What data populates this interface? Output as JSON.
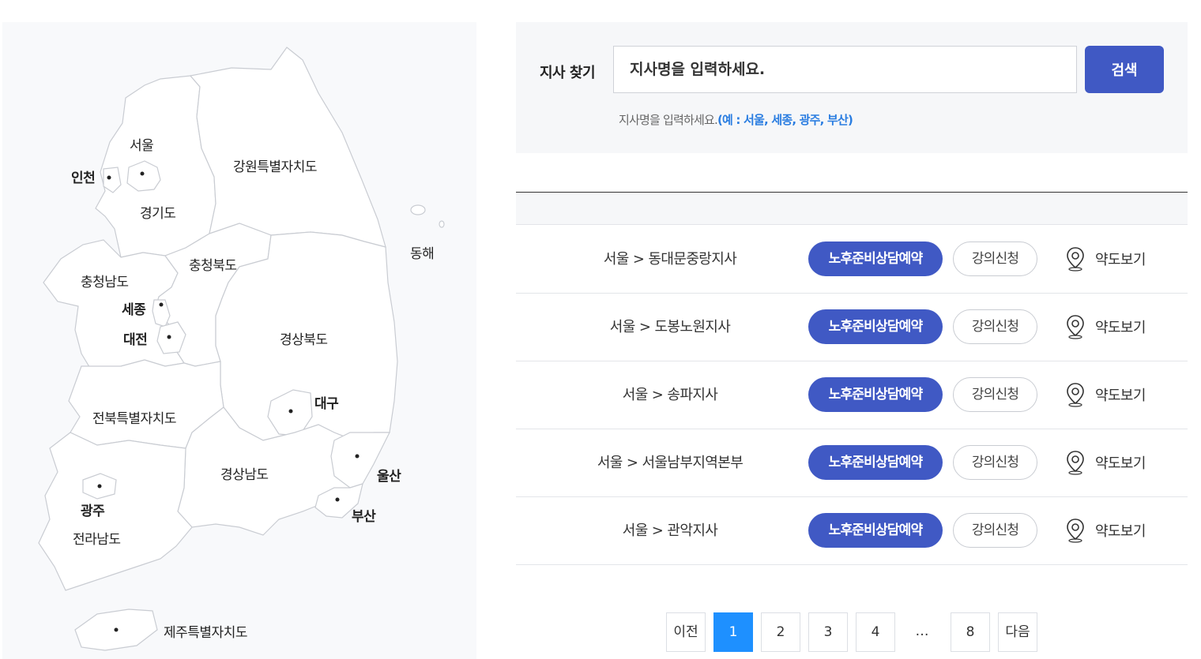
{
  "map": {
    "regions": {
      "gangwon": "강원특별자치도",
      "gyeonggi": "경기도",
      "chungbuk": "충청북도",
      "chungnam": "충청남도",
      "gyeongbuk": "경상북도",
      "jeonbuk": "전북특별자치도",
      "gyeongnam": "경상남도",
      "jeonnam": "전라남도",
      "jeju": "제주특별자치도",
      "east_sea": "동해"
    },
    "cities": {
      "seoul": "서울",
      "incheon": "인천",
      "sejong": "세종",
      "daejeon": "대전",
      "daegu": "대구",
      "ulsan": "울산",
      "busan": "부산",
      "gwangju": "광주"
    }
  },
  "search": {
    "label": "지사 찾기",
    "placeholder": "지사명을 입력하세요.",
    "button": "검색",
    "hint": "지사명을 입력하세요.",
    "hint_example": "(예 : 서울, 세종, 광주, 부산)"
  },
  "results": [
    {
      "name": "서울 > 동대문중랑지사",
      "consult": "노후준비상담예약",
      "lecture": "강의신청",
      "map": "약도보기"
    },
    {
      "name": "서울 > 도봉노원지사",
      "consult": "노후준비상담예약",
      "lecture": "강의신청",
      "map": "약도보기"
    },
    {
      "name": "서울 > 송파지사",
      "consult": "노후준비상담예약",
      "lecture": "강의신청",
      "map": "약도보기"
    },
    {
      "name": "서울 > 서울남부지역본부",
      "consult": "노후준비상담예약",
      "lecture": "강의신청",
      "map": "약도보기"
    },
    {
      "name": "서울 > 관악지사",
      "consult": "노후준비상담예약",
      "lecture": "강의신청",
      "map": "약도보기"
    }
  ],
  "pagination": {
    "prev": "이전",
    "pages": [
      "1",
      "2",
      "3",
      "4"
    ],
    "ellipsis": "…",
    "last": "8",
    "next": "다음",
    "current": "1"
  },
  "colors": {
    "primary": "#4059c4",
    "active_page": "#1e90ff",
    "hint_link": "#2a7de1",
    "panel_bg": "#f6f7f9"
  }
}
